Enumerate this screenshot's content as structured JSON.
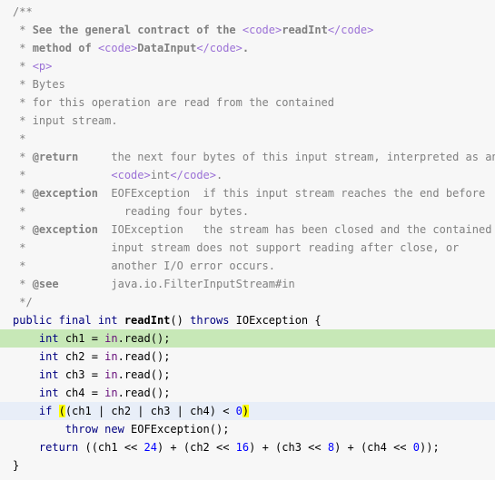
{
  "editor": {
    "lines": [
      {
        "tokens": [
          {
            "t": "/**",
            "c": "comment"
          }
        ]
      },
      {
        "tokens": [
          {
            "t": " * ",
            "c": "comment"
          },
          {
            "t": "See the general contract of the ",
            "c": "javadoc-bold"
          },
          {
            "t": "<code>",
            "c": "tag"
          },
          {
            "t": "readInt",
            "c": "javadoc-bold"
          },
          {
            "t": "</code>",
            "c": "tag"
          }
        ]
      },
      {
        "tokens": [
          {
            "t": " * ",
            "c": "comment"
          },
          {
            "t": "method of ",
            "c": "javadoc-bold"
          },
          {
            "t": "<code>",
            "c": "tag"
          },
          {
            "t": "DataInput",
            "c": "javadoc-bold"
          },
          {
            "t": "</code>",
            "c": "tag"
          },
          {
            "t": ".",
            "c": "javadoc-bold"
          }
        ]
      },
      {
        "tokens": [
          {
            "t": " * ",
            "c": "comment"
          },
          {
            "t": "<p>",
            "c": "tag"
          }
        ]
      },
      {
        "tokens": [
          {
            "t": " * Bytes",
            "c": "comment"
          }
        ]
      },
      {
        "tokens": [
          {
            "t": " * for this operation are read from the contained",
            "c": "comment"
          }
        ]
      },
      {
        "tokens": [
          {
            "t": " * input stream.",
            "c": "comment"
          }
        ]
      },
      {
        "tokens": [
          {
            "t": " *",
            "c": "comment"
          }
        ]
      },
      {
        "tokens": [
          {
            "t": " * ",
            "c": "comment"
          },
          {
            "t": "@return",
            "c": "javadoc-bold"
          },
          {
            "t": "     the next four bytes of this input stream, interpreted as an",
            "c": "comment"
          }
        ]
      },
      {
        "tokens": [
          {
            "t": " *             ",
            "c": "comment"
          },
          {
            "t": "<code>",
            "c": "tag"
          },
          {
            "t": "int",
            "c": "comment"
          },
          {
            "t": "</code>",
            "c": "tag"
          },
          {
            "t": ".",
            "c": "comment"
          }
        ]
      },
      {
        "tokens": [
          {
            "t": " * ",
            "c": "comment"
          },
          {
            "t": "@exception",
            "c": "javadoc-bold"
          },
          {
            "t": "  EOFException  if this input stream reaches the end before",
            "c": "comment"
          }
        ]
      },
      {
        "tokens": [
          {
            "t": " *               reading four bytes.",
            "c": "comment"
          }
        ]
      },
      {
        "tokens": [
          {
            "t": " * ",
            "c": "comment"
          },
          {
            "t": "@exception",
            "c": "javadoc-bold"
          },
          {
            "t": "  IOException   the stream has been closed and the contained",
            "c": "comment"
          }
        ]
      },
      {
        "tokens": [
          {
            "t": " *             input stream does not support reading after close, or",
            "c": "comment"
          }
        ]
      },
      {
        "tokens": [
          {
            "t": " *             another I/O error occurs.",
            "c": "comment"
          }
        ]
      },
      {
        "tokens": [
          {
            "t": " * ",
            "c": "comment"
          },
          {
            "t": "@see",
            "c": "javadoc-bold"
          },
          {
            "t": "        java.io.FilterInputStream#in",
            "c": "comment"
          }
        ]
      },
      {
        "tokens": [
          {
            "t": " */",
            "c": "comment"
          }
        ]
      },
      {
        "tokens": [
          {
            "t": "public final int ",
            "c": "kw"
          },
          {
            "t": "readInt",
            "c": "method"
          },
          {
            "t": "() ",
            "c": "plain"
          },
          {
            "t": "throws ",
            "c": "kw"
          },
          {
            "t": "IOException {",
            "c": "plain"
          }
        ]
      },
      {
        "hl": "green",
        "tokens": [
          {
            "t": "    ",
            "c": "plain"
          },
          {
            "t": "int ",
            "c": "kw"
          },
          {
            "t": "ch1 = ",
            "c": "plain"
          },
          {
            "t": "in",
            "c": "field"
          },
          {
            "t": ".read();",
            "c": "plain"
          }
        ]
      },
      {
        "tokens": [
          {
            "t": "    ",
            "c": "plain"
          },
          {
            "t": "int ",
            "c": "kw"
          },
          {
            "t": "ch2 = ",
            "c": "plain"
          },
          {
            "t": "in",
            "c": "field"
          },
          {
            "t": ".read();",
            "c": "plain"
          }
        ]
      },
      {
        "tokens": [
          {
            "t": "    ",
            "c": "plain"
          },
          {
            "t": "int ",
            "c": "kw"
          },
          {
            "t": "ch3 = ",
            "c": "plain"
          },
          {
            "t": "in",
            "c": "field"
          },
          {
            "t": ".read();",
            "c": "plain"
          }
        ]
      },
      {
        "tokens": [
          {
            "t": "    ",
            "c": "plain"
          },
          {
            "t": "int ",
            "c": "kw"
          },
          {
            "t": "ch4 = ",
            "c": "plain"
          },
          {
            "t": "in",
            "c": "field"
          },
          {
            "t": ".read();",
            "c": "plain"
          }
        ]
      },
      {
        "hl": "blue",
        "tokens": [
          {
            "t": "    ",
            "c": "plain"
          },
          {
            "t": "if ",
            "c": "kw"
          },
          {
            "t": "(",
            "c": "brace"
          },
          {
            "t": "(ch1 | ch2 | ch3 | ch4) < ",
            "c": "plain"
          },
          {
            "t": "0",
            "c": "number"
          },
          {
            "t": ")",
            "c": "brace"
          }
        ]
      },
      {
        "tokens": [
          {
            "t": "        ",
            "c": "plain"
          },
          {
            "t": "throw new ",
            "c": "kw"
          },
          {
            "t": "EOFException();",
            "c": "plain"
          }
        ]
      },
      {
        "tokens": [
          {
            "t": "    ",
            "c": "plain"
          },
          {
            "t": "return ",
            "c": "kw"
          },
          {
            "t": "((ch1 << ",
            "c": "plain"
          },
          {
            "t": "24",
            "c": "number"
          },
          {
            "t": ") + (ch2 << ",
            "c": "plain"
          },
          {
            "t": "16",
            "c": "number"
          },
          {
            "t": ") + (ch3 << ",
            "c": "plain"
          },
          {
            "t": "8",
            "c": "number"
          },
          {
            "t": ") + (ch4 << ",
            "c": "plain"
          },
          {
            "t": "0",
            "c": "number"
          },
          {
            "t": "));",
            "c": "plain"
          }
        ]
      },
      {
        "tokens": [
          {
            "t": "}",
            "c": "plain"
          }
        ]
      }
    ]
  }
}
